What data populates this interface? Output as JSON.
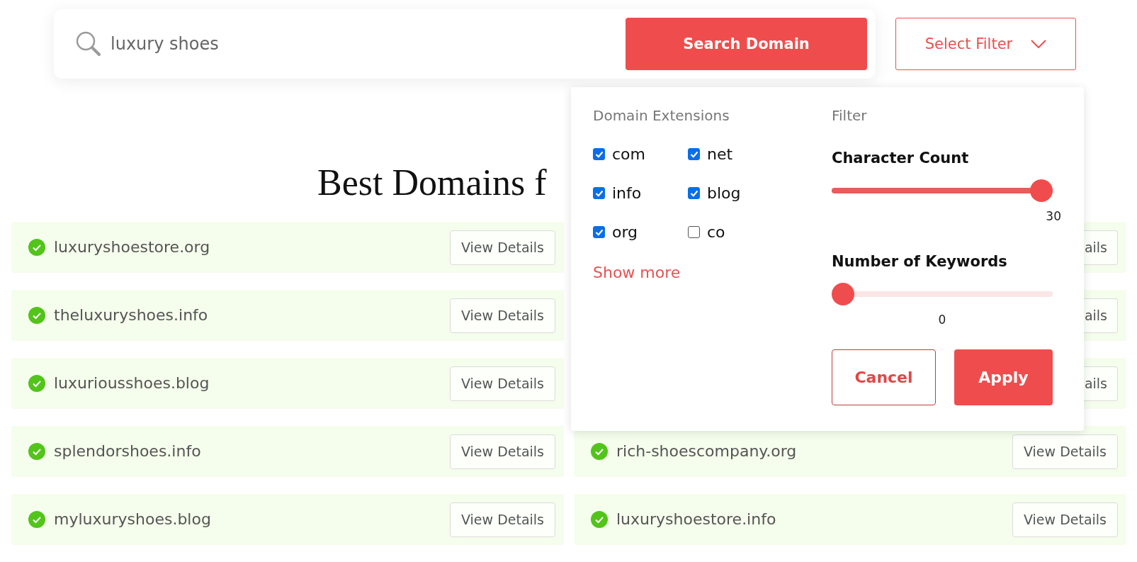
{
  "search": {
    "value": "luxury shoes",
    "button": "Search Domain"
  },
  "filter_button": {
    "label": "Select Filter",
    "expanded": true
  },
  "heading": "Best Domains f",
  "left_column": [
    {
      "domain": "luxuryshoestore.org",
      "available": true,
      "button": "View Details"
    },
    {
      "domain": "theluxuryshoes.info",
      "available": true,
      "button": "View Details"
    },
    {
      "domain": "luxuriousshoes.blog",
      "available": true,
      "button": "View Details"
    },
    {
      "domain": "splendorshoes.info",
      "available": true,
      "button": "View Details"
    },
    {
      "domain": "myluxuryshoes.blog",
      "available": true,
      "button": "View Details"
    }
  ],
  "right_column": [
    {
      "button": "ails"
    },
    {
      "button": "ails"
    },
    {
      "button": "ails"
    },
    {
      "domain": "rich-shoescompany.org",
      "available": true,
      "button": "View Details"
    },
    {
      "domain": "luxuryshoestore.info",
      "available": true,
      "button": "View Details"
    }
  ],
  "filter_panel": {
    "extensions_title": "Domain Extensions",
    "extensions": [
      {
        "label": "com",
        "checked": true
      },
      {
        "label": "net",
        "checked": true
      },
      {
        "label": "info",
        "checked": true
      },
      {
        "label": "blog",
        "checked": true
      },
      {
        "label": "org",
        "checked": true
      },
      {
        "label": "co",
        "checked": false
      }
    ],
    "show_more": "Show more",
    "filter_title": "Filter",
    "sliders": [
      {
        "label": "Character Count",
        "level": 1,
        "reading": "30"
      },
      {
        "label": "Number of Keywords",
        "level": 0,
        "reading": "0"
      }
    ],
    "cancel": "Cancel",
    "apply": "Apply"
  }
}
